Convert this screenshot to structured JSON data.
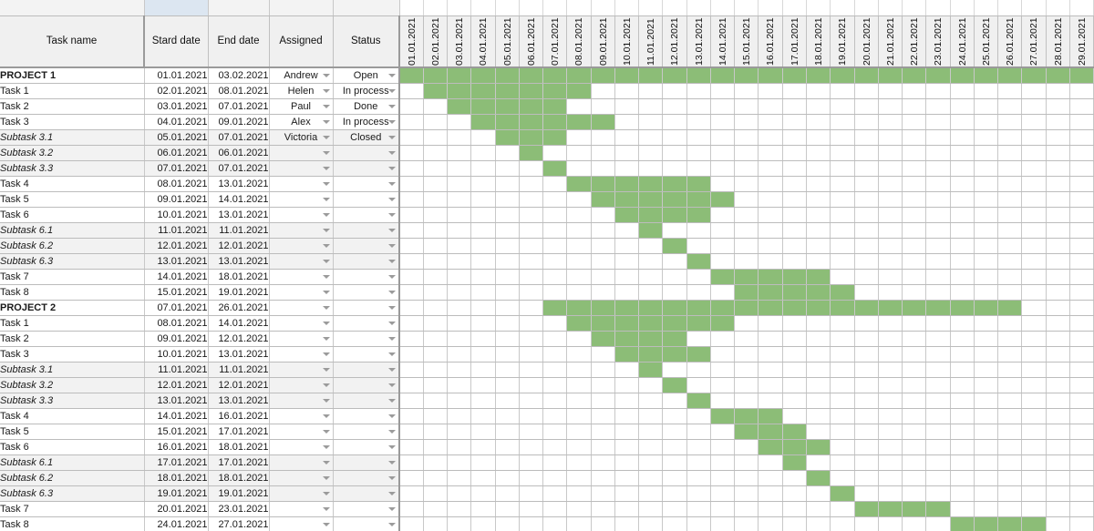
{
  "app": {
    "type": "spreadsheet-gantt-chart"
  },
  "columns": {
    "task_name": "Task name",
    "start_date": "Stard date",
    "end_date": "End date",
    "assigned": "Assigned",
    "status": "Status"
  },
  "timeline": {
    "dates": [
      "01.01.2021",
      "02.01.2021",
      "03.01.2021",
      "04.01.2021",
      "05.01.2021",
      "06.01.2021",
      "07.01.2021",
      "08.01.2021",
      "09.01.2021",
      "10.01.2021",
      "11.01.2021",
      "12.01.2021",
      "13.01.2021",
      "14.01.2021",
      "15.01.2021",
      "16.01.2021",
      "17.01.2021",
      "18.01.2021",
      "19.01.2021",
      "20.01.2021",
      "21.01.2021",
      "22.01.2021",
      "23.01.2021",
      "24.01.2021",
      "25.01.2021",
      "26.01.2021",
      "27.01.2021",
      "28.01.2021",
      "29.01.2021"
    ]
  },
  "colors": {
    "bar_green": "#8cbd77",
    "header_gray": "#f0f0f0",
    "alt_row_gray": "#f2f2f2",
    "grid_line": "#c0c0c0",
    "selection_blue": "#dce6f1"
  },
  "icons": {
    "dropdown": "chevron-down-icon"
  },
  "rows": [
    {
      "name": "PROJECT 1",
      "kind": "project",
      "start": "01.01.2021",
      "end": "03.02.2021",
      "assigned": "Andrew",
      "status": "Open",
      "bar_start": 1,
      "bar_end": 29
    },
    {
      "name": "Task 1",
      "kind": "task",
      "start": "02.01.2021",
      "end": "08.01.2021",
      "assigned": "Helen",
      "status": "In process",
      "bar_start": 2,
      "bar_end": 8
    },
    {
      "name": "Task 2",
      "kind": "task",
      "start": "03.01.2021",
      "end": "07.01.2021",
      "assigned": "Paul",
      "status": "Done",
      "bar_start": 3,
      "bar_end": 7
    },
    {
      "name": "Task 3",
      "kind": "task",
      "start": "04.01.2021",
      "end": "09.01.2021",
      "assigned": "Alex",
      "status": "In process",
      "bar_start": 4,
      "bar_end": 9
    },
    {
      "name": "Subtask 3.1",
      "kind": "subtask",
      "start": "05.01.2021",
      "end": "07.01.2021",
      "assigned": "Victoria",
      "status": "Closed",
      "bar_start": 5,
      "bar_end": 7
    },
    {
      "name": "Subtask 3.2",
      "kind": "subtask",
      "start": "06.01.2021",
      "end": "06.01.2021",
      "assigned": "",
      "status": "",
      "bar_start": 6,
      "bar_end": 6
    },
    {
      "name": "Subtask 3.3",
      "kind": "subtask",
      "start": "07.01.2021",
      "end": "07.01.2021",
      "assigned": "",
      "status": "",
      "bar_start": 7,
      "bar_end": 7
    },
    {
      "name": "Task 4",
      "kind": "task",
      "start": "08.01.2021",
      "end": "13.01.2021",
      "assigned": "",
      "status": "",
      "bar_start": 8,
      "bar_end": 13
    },
    {
      "name": "Task 5",
      "kind": "task",
      "start": "09.01.2021",
      "end": "14.01.2021",
      "assigned": "",
      "status": "",
      "bar_start": 9,
      "bar_end": 14
    },
    {
      "name": "Task 6",
      "kind": "task",
      "start": "10.01.2021",
      "end": "13.01.2021",
      "assigned": "",
      "status": "",
      "bar_start": 10,
      "bar_end": 13
    },
    {
      "name": "Subtask 6.1",
      "kind": "subtask",
      "start": "11.01.2021",
      "end": "11.01.2021",
      "assigned": "",
      "status": "",
      "bar_start": 11,
      "bar_end": 11
    },
    {
      "name": "Subtask 6.2",
      "kind": "subtask",
      "start": "12.01.2021",
      "end": "12.01.2021",
      "assigned": "",
      "status": "",
      "bar_start": 12,
      "bar_end": 12
    },
    {
      "name": "Subtask 6.3",
      "kind": "subtask",
      "start": "13.01.2021",
      "end": "13.01.2021",
      "assigned": "",
      "status": "",
      "bar_start": 13,
      "bar_end": 13
    },
    {
      "name": "Task 7",
      "kind": "task",
      "start": "14.01.2021",
      "end": "18.01.2021",
      "assigned": "",
      "status": "",
      "bar_start": 14,
      "bar_end": 18
    },
    {
      "name": "Task 8",
      "kind": "task",
      "start": "15.01.2021",
      "end": "19.01.2021",
      "assigned": "",
      "status": "",
      "bar_start": 15,
      "bar_end": 19
    },
    {
      "name": "PROJECT 2",
      "kind": "project",
      "start": "07.01.2021",
      "end": "26.01.2021",
      "assigned": "",
      "status": "",
      "bar_start": 7,
      "bar_end": 26
    },
    {
      "name": "Task 1",
      "kind": "task",
      "start": "08.01.2021",
      "end": "14.01.2021",
      "assigned": "",
      "status": "",
      "bar_start": 8,
      "bar_end": 14
    },
    {
      "name": "Task 2",
      "kind": "task",
      "start": "09.01.2021",
      "end": "12.01.2021",
      "assigned": "",
      "status": "",
      "bar_start": 9,
      "bar_end": 12
    },
    {
      "name": "Task 3",
      "kind": "task",
      "start": "10.01.2021",
      "end": "13.01.2021",
      "assigned": "",
      "status": "",
      "bar_start": 10,
      "bar_end": 13
    },
    {
      "name": "Subtask 3.1",
      "kind": "subtask",
      "start": "11.01.2021",
      "end": "11.01.2021",
      "assigned": "",
      "status": "",
      "bar_start": 11,
      "bar_end": 11
    },
    {
      "name": "Subtask 3.2",
      "kind": "subtask",
      "start": "12.01.2021",
      "end": "12.01.2021",
      "assigned": "",
      "status": "",
      "bar_start": 12,
      "bar_end": 12
    },
    {
      "name": "Subtask 3.3",
      "kind": "subtask",
      "start": "13.01.2021",
      "end": "13.01.2021",
      "assigned": "",
      "status": "",
      "bar_start": 13,
      "bar_end": 13
    },
    {
      "name": "Task 4",
      "kind": "task",
      "start": "14.01.2021",
      "end": "16.01.2021",
      "assigned": "",
      "status": "",
      "bar_start": 14,
      "bar_end": 16
    },
    {
      "name": "Task 5",
      "kind": "task",
      "start": "15.01.2021",
      "end": "17.01.2021",
      "assigned": "",
      "status": "",
      "bar_start": 15,
      "bar_end": 17
    },
    {
      "name": "Task 6",
      "kind": "task",
      "start": "16.01.2021",
      "end": "18.01.2021",
      "assigned": "",
      "status": "",
      "bar_start": 16,
      "bar_end": 18
    },
    {
      "name": "Subtask 6.1",
      "kind": "subtask",
      "start": "17.01.2021",
      "end": "17.01.2021",
      "assigned": "",
      "status": "",
      "bar_start": 17,
      "bar_end": 17
    },
    {
      "name": "Subtask 6.2",
      "kind": "subtask",
      "start": "18.01.2021",
      "end": "18.01.2021",
      "assigned": "",
      "status": "",
      "bar_start": 18,
      "bar_end": 18
    },
    {
      "name": "Subtask 6.3",
      "kind": "subtask",
      "start": "19.01.2021",
      "end": "19.01.2021",
      "assigned": "",
      "status": "",
      "bar_start": 19,
      "bar_end": 19
    },
    {
      "name": "Task 7",
      "kind": "task",
      "start": "20.01.2021",
      "end": "23.01.2021",
      "assigned": "",
      "status": "",
      "bar_start": 20,
      "bar_end": 23
    },
    {
      "name": "Task 8",
      "kind": "task",
      "start": "24.01.2021",
      "end": "27.01.2021",
      "assigned": "",
      "status": "",
      "bar_start": 24,
      "bar_end": 27
    }
  ]
}
